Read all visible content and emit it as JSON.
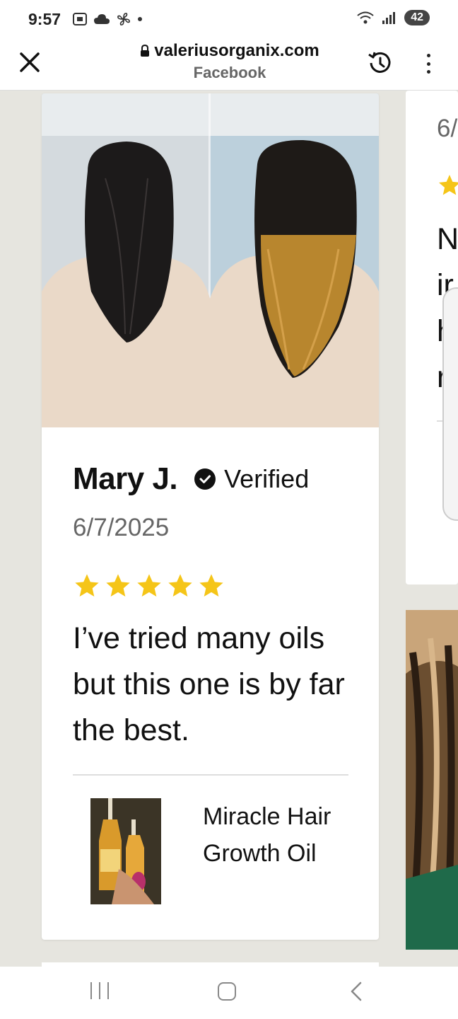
{
  "status_bar": {
    "time": "9:57",
    "battery": "42",
    "left_icons": [
      "screenshot-icon",
      "cloud-icon",
      "pinwheel-icon",
      "dot-icon"
    ]
  },
  "browser": {
    "url": "valeriusorganix.com",
    "source": "Facebook"
  },
  "review": {
    "name": "Mary J.",
    "verified_label": "Verified",
    "date": "6/7/2025",
    "rating": 5,
    "text": "I’ve tried many oils but this one is by far the best.",
    "product_name": "Miracle Hair Growth Oil"
  },
  "side_review": {
    "date_partial": "6/",
    "text_partial": "N\nir\nh\nr"
  },
  "colors": {
    "star": "#f5c518",
    "background": "#e6e5df",
    "card": "#ffffff"
  }
}
